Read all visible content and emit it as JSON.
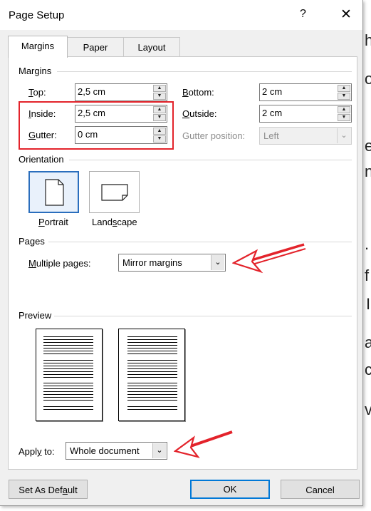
{
  "background_text": [
    "h",
    "o",
    "e",
    "n",
    ".",
    "f",
    "I",
    "a",
    "c",
    "v"
  ],
  "dialog": {
    "title": "Page Setup",
    "help": "?",
    "close": "✕"
  },
  "tabs": [
    {
      "label": "Margins",
      "active": true
    },
    {
      "label": "Paper",
      "active": false
    },
    {
      "label": "Layout",
      "active": false
    }
  ],
  "margins": {
    "group_label": "Margins",
    "top": {
      "label": "Top:",
      "value": "2,5 cm"
    },
    "inside": {
      "label": "Inside:",
      "value": "2,5 cm"
    },
    "gutter": {
      "label": "Gutter:",
      "value": "0 cm"
    },
    "bottom": {
      "label": "Bottom:",
      "value": "2 cm"
    },
    "outside": {
      "label": "Outside:",
      "value": "2 cm"
    },
    "gutter_position": {
      "label": "Gutter position:",
      "value": "Left"
    }
  },
  "orientation": {
    "group_label": "Orientation",
    "portrait": "Portrait",
    "landscape": "Landscape"
  },
  "pages": {
    "group_label": "Pages",
    "multiple_label": "Multiple pages:",
    "multiple_value": "Mirror margins"
  },
  "preview": {
    "group_label": "Preview"
  },
  "apply": {
    "label": "Apply to:",
    "value": "Whole document"
  },
  "buttons": {
    "default": "Set As Default",
    "ok": "OK",
    "cancel": "Cancel"
  },
  "colors": {
    "highlight": "#e3232b",
    "accent": "#0078d7"
  }
}
